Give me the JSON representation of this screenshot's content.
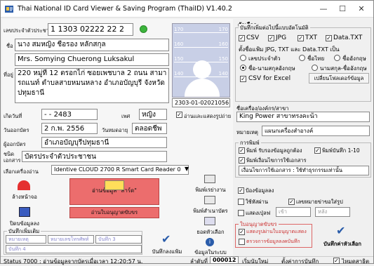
{
  "window": {
    "title": "Thai National ID Card Viewer & Saving Program (ThaiID) V1.40.2"
  },
  "card": {
    "id_label": "เลขประจำตัวประชาชน",
    "id": "1 1303 02222 22 2",
    "name_th_label": "ชื่อ",
    "name_th": "นาง สมหญิง ชือรอง หลักสกุล",
    "name_en": "Mrs. Somying Chuerong Luksakul",
    "address_label": "ที่อยู่",
    "address": "220 หมู่ที่ 12 ตรอกไก่ ซอยเพชบาล 2 ถนน สามารถแนท์ ตำบลสายหมนหลาง อำเภอบัญบุรี จังหวัดปทุมธานี",
    "photo_ticks": [
      "170",
      "170",
      "160",
      "160",
      "150",
      "150",
      "140",
      "140"
    ],
    "photo_code": "2303-01-02021056",
    "dob_label": "เกิดวันที่",
    "dob": "- - 2483",
    "sex_label": "เพศ",
    "sex": "หญิง",
    "issue_label": "วันออกบัตร",
    "issue": "2 ก.พ. 2556",
    "expire_label": "วันหมดอายุ",
    "expire": "ตลอดชีพ",
    "issuer_label": "ผู้ออกบัตร",
    "issuer": "อำเภอบัญบุรีปทุมธานี",
    "type_label": "ชนิดเอกสาร",
    "type": "บัตรประจำตัวประชาชน",
    "show_image_label": "อ่านและแสดงรูปถ่าย"
  },
  "reader": {
    "label": "เลือกเครื่องอ่าน",
    "value": "Identive CLOUD 2700 R Smart Card Reader 0"
  },
  "buttons": {
    "clear": "ล้างหน้าจอ",
    "save_data": "ปิดบข้อมูลลง",
    "read_card": "อ่านข้อมูล \"สาร์ด\"",
    "read_passport": "อ่านใบอนุญาตขับขร",
    "print_sheet": "พิมพ์เรย่างาน",
    "print_id": "พิมพ์สำเนาบัตร",
    "ok": "ยอดหัวเลือก",
    "save_set": "บันทึกลงแฟ้ม",
    "folder": "ข้อมูลในระบบ",
    "save_settings": "บันทึกค่าหัวเลือก",
    "change_folder": "เปลี่ยนโฟลเดอร์ข้อมูล"
  },
  "notes": {
    "group": "บันทึกเพิ่มเติม",
    "note1": "หมายเหตุ",
    "note2": "หมายเลขโทรศัพท์",
    "note3": "บันทึก 3",
    "note4": "บันทึก 4"
  },
  "options": {
    "title": "ตัวเลือก",
    "save_group": "บันทึกเพิ่มต่อไปนี้แบบอัตโนมัติ",
    "csv": "CSV",
    "jpg": "JPG",
    "txt": "TXT",
    "datatxt": "Data.TXT",
    "filename_label": "ตั้งชื่อแฟ้ม JPG, TXT และ Data.TXT เป็น",
    "r1": "เลขประจำตัว",
    "r2": "ชื่อไทย",
    "r3": "ชื่ออังกฤษ",
    "r4": "ชื่อ-นามสกุลอังกฤษ",
    "r5": "นามสกุล-ชื่ออังกฤษ",
    "csv_excel": "CSV for Excel",
    "branch_label": "ชื่อเครื่อง/องค์กร/สาขา",
    "branch": "King Power สาขาทรงคะน้า",
    "remark_label": "หมายเหตุ",
    "remark": "แผนกเครื่องสำอางค์",
    "print_group": "การพิมพ์",
    "p1": "พิมพ์ รับรองข้อมูลถูกต้อง",
    "p2": "พิมพ์บันทึก 1-10",
    "p3": "พิมพ์เงื่อนไขการใช้เอกสาร",
    "cond_text": "เงื่อนไขการใช้เอกสาร : ใช้ทำธุรกรรมเท่านั้น",
    "photo_opt": "ป้องข้อมูลลง",
    "redact": "ใช้หัสผ่าน",
    "crop": "เลขหมายข่าขอใส่รูป",
    "show_all": "แสดงเปุ่ลฟ",
    "all_val": "เข้า",
    "from_val": "หลัง",
    "license_group": "ใบอนุญาตขับขร",
    "l1": "แสดงรูปผ่านใบอนุญาตแสดง",
    "l2": "ตรวจการข้อมูลลงคบันทึก"
  },
  "status": {
    "text": "Status 7000 : อ่านข้อมูลจากบัตรเมื่อเวลา 12:20:57 น.",
    "seq_label": "ลำดับที่",
    "seq": "000012",
    "new": "เริ่มนับใหม่",
    "settings": "ตั้งค่าการบันทึก",
    "hide_label": "ไหมดสาธิต"
  }
}
